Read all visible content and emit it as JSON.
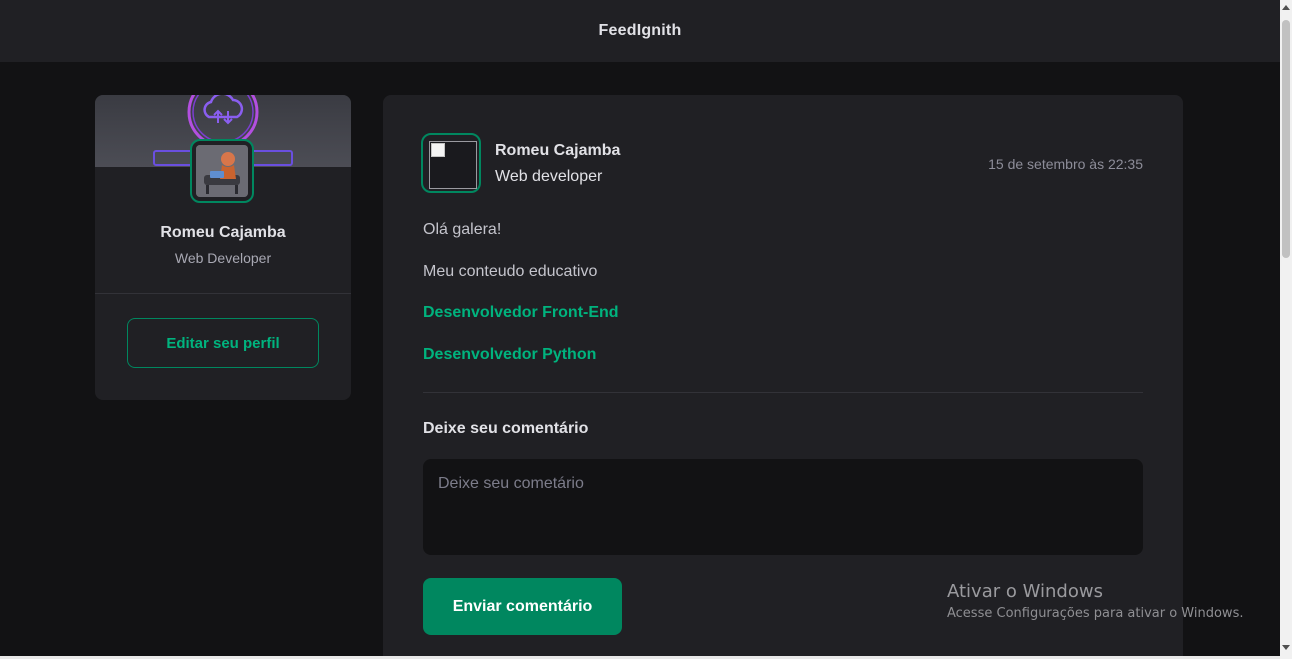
{
  "app": {
    "title": "FeedIgnith"
  },
  "sidebar": {
    "name": "Romeu Cajamba",
    "role": "Web Developer",
    "edit_label": "Editar seu perfil"
  },
  "post": {
    "author": "Romeu Cajamba",
    "role": "Web developer",
    "time": "15 de setembro às 22:35",
    "content": [
      "Olá galera!",
      "Meu conteudo educativo"
    ],
    "links": [
      "Desenvolvedor Front-End",
      "Desenvolvedor Python"
    ],
    "comment_title": "Deixe seu comentário",
    "comment_placeholder": "Deixe seu cometário",
    "send_label": "Enviar comentário"
  },
  "watermark": {
    "title": "Ativar o Windows",
    "subtitle": "Acesse Configurações para ativar o Windows."
  },
  "colors": {
    "background": "#121214",
    "surface": "#202024",
    "accent": "#00875f",
    "accent_light": "#00b37e"
  }
}
